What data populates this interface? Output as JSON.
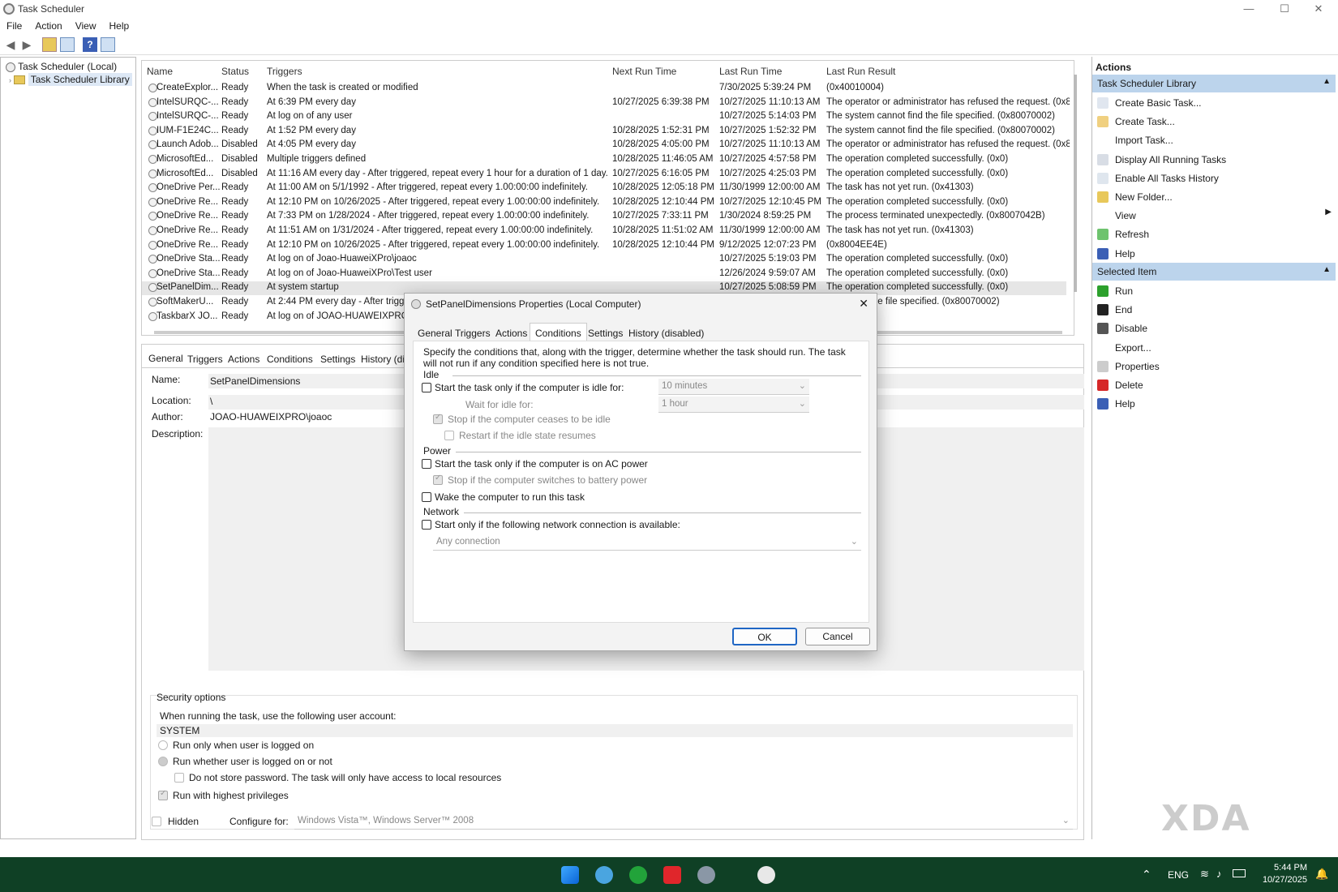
{
  "window": {
    "title": "Task Scheduler",
    "minimize": "—",
    "maximize": "☐",
    "close": "✕"
  },
  "menu": [
    "File",
    "Action",
    "View",
    "Help"
  ],
  "tree": {
    "root": "Task Scheduler (Local)",
    "library": "Task Scheduler Library"
  },
  "list": {
    "headers": [
      "Name",
      "Status",
      "Triggers",
      "Next Run Time",
      "Last Run Time",
      "Last Run Result"
    ],
    "rows": [
      [
        "CreateExplor...",
        "Ready",
        "When the task is created or modified",
        "",
        "7/30/2025 5:39:24 PM",
        "(0x40010004)"
      ],
      [
        "IntelSURQC-...",
        "Ready",
        "At 6:39 PM every day",
        "10/27/2025 6:39:38 PM",
        "10/27/2025 11:10:13 AM",
        "The operator or administrator has refused the request. (0x8007"
      ],
      [
        "IntelSURQC-...",
        "Ready",
        "At log on of any user",
        "",
        "10/27/2025 5:14:03 PM",
        "The system cannot find the file specified. (0x80070002)"
      ],
      [
        "IUM-F1E24C...",
        "Ready",
        "At 1:52 PM every day",
        "10/28/2025 1:52:31 PM",
        "10/27/2025 1:52:32 PM",
        "The system cannot find the file specified. (0x80070002)"
      ],
      [
        "Launch Adob...",
        "Disabled",
        "At 4:05 PM every day",
        "10/28/2025 4:05:00 PM",
        "10/27/2025 11:10:13 AM",
        "The operator or administrator has refused the request. (0x8007"
      ],
      [
        "MicrosoftEd...",
        "Disabled",
        "Multiple triggers defined",
        "10/28/2025 11:46:05 AM",
        "10/27/2025 4:57:58 PM",
        "The operation completed successfully. (0x0)"
      ],
      [
        "MicrosoftEd...",
        "Disabled",
        "At 11:16 AM every day - After triggered, repeat every 1 hour for a duration of 1 day.",
        "10/27/2025 6:16:05 PM",
        "10/27/2025 4:25:03 PM",
        "The operation completed successfully. (0x0)"
      ],
      [
        "OneDrive Per...",
        "Ready",
        "At 11:00 AM on 5/1/1992 - After triggered, repeat every 1.00:00:00 indefinitely.",
        "10/28/2025 12:05:18 PM",
        "11/30/1999 12:00:00 AM",
        "The task has not yet run. (0x41303)"
      ],
      [
        "OneDrive Re...",
        "Ready",
        "At 12:10 PM on 10/26/2025 - After triggered, repeat every 1.00:00:00 indefinitely.",
        "10/28/2025 12:10:44 PM",
        "10/27/2025 12:10:45 PM",
        "The operation completed successfully. (0x0)"
      ],
      [
        "OneDrive Re...",
        "Ready",
        "At 7:33 PM on 1/28/2024 - After triggered, repeat every 1.00:00:00 indefinitely.",
        "10/27/2025 7:33:11 PM",
        "1/30/2024 8:59:25 PM",
        "The process terminated unexpectedly. (0x8007042B)"
      ],
      [
        "OneDrive Re...",
        "Ready",
        "At 11:51 AM on 1/31/2024 - After triggered, repeat every 1.00:00:00 indefinitely.",
        "10/28/2025 11:51:02 AM",
        "11/30/1999 12:00:00 AM",
        "The task has not yet run. (0x41303)"
      ],
      [
        "OneDrive Re...",
        "Ready",
        "At 12:10 PM on 10/26/2025 - After triggered, repeat every 1.00:00:00 indefinitely.",
        "10/28/2025 12:10:44 PM",
        "9/12/2025 12:07:23 PM",
        "(0x8004EE4E)"
      ],
      [
        "OneDrive Sta...",
        "Ready",
        "At log on of Joao-HuaweiXPro\\joaoc",
        "",
        "10/27/2025 5:19:03 PM",
        "The operation completed successfully. (0x0)"
      ],
      [
        "OneDrive Sta...",
        "Ready",
        "At log on of Joao-HuaweiXPro\\Test user",
        "",
        "12/26/2024 9:59:07 AM",
        "The operation completed successfully. (0x0)"
      ],
      [
        "SetPanelDim...",
        "Ready",
        "At system startup",
        "",
        "10/27/2025 5:08:59 PM",
        "The operation completed successfully. (0x0)"
      ],
      [
        "SoftMakerU...",
        "Ready",
        "At 2:44 PM every day - After trigg",
        "",
        "",
        "annot find the file specified. (0x80070002)"
      ],
      [
        "TaskbarX JO...",
        "Ready",
        "At log on of JOAO-HUAWEIXPRO\\jo",
        "",
        "",
        ""
      ]
    ]
  },
  "detail": {
    "tabs": [
      "General",
      "Triggers",
      "Actions",
      "Conditions",
      "Settings",
      "History (dis"
    ],
    "name_label": "Name:",
    "name": "SetPanelDimensions",
    "location_label": "Location:",
    "location": "\\",
    "author_label": "Author:",
    "author": "JOAO-HUAWEIXPRO\\joaoc",
    "description_label": "Description:",
    "security_title": "Security options",
    "account_prompt": "When running the task, use the following user account:",
    "account": "SYSTEM",
    "run_logged_on": "Run only when user is logged on",
    "run_whether": "Run whether user is logged on or not",
    "no_store_pw": "Do not store password.  The task will only have access to local resources",
    "highest": "Run with highest privileges",
    "hidden": "Hidden",
    "configure_label": "Configure for:",
    "configure_value": "Windows Vista™, Windows Server™ 2008"
  },
  "actions": {
    "title": "Actions",
    "section1": "Task Scheduler Library",
    "items1": [
      "Create Basic Task...",
      "Create Task...",
      "Import Task...",
      "Display All Running Tasks",
      "Enable All Tasks History",
      "New Folder...",
      "View",
      "Refresh",
      "Help"
    ],
    "section2": "Selected Item",
    "items2": [
      "Run",
      "End",
      "Disable",
      "Export...",
      "Properties",
      "Delete",
      "Help"
    ]
  },
  "dialog": {
    "title": "SetPanelDimensions Properties (Local Computer)",
    "tabs": [
      "General",
      "Triggers",
      "Actions",
      "Conditions",
      "Settings",
      "History (disabled)"
    ],
    "intro": "Specify the conditions that, along with the trigger, determine whether the task should run.  The task will not run  if any condition specified here is not true.",
    "idle": "Idle",
    "idle_start": "Start the task only if the computer is idle for:",
    "idle_for": "10 minutes",
    "wait_label": "Wait for idle for:",
    "wait_value": "1 hour",
    "stop_idle": "Stop if the computer ceases to be idle",
    "restart_idle": "Restart if the idle state resumes",
    "power": "Power",
    "ac_power": "Start the task only if the computer is on AC power",
    "battery": "Stop if the computer switches to battery power",
    "wake": "Wake the computer to run this task",
    "network": "Network",
    "net_start": "Start only if the following network connection is available:",
    "net_value": "Any connection",
    "ok": "OK",
    "cancel": "Cancel"
  },
  "taskbar": {
    "lang": "ENG",
    "time": "5:44 PM",
    "date": "10/27/2025"
  },
  "watermark": "XDA"
}
